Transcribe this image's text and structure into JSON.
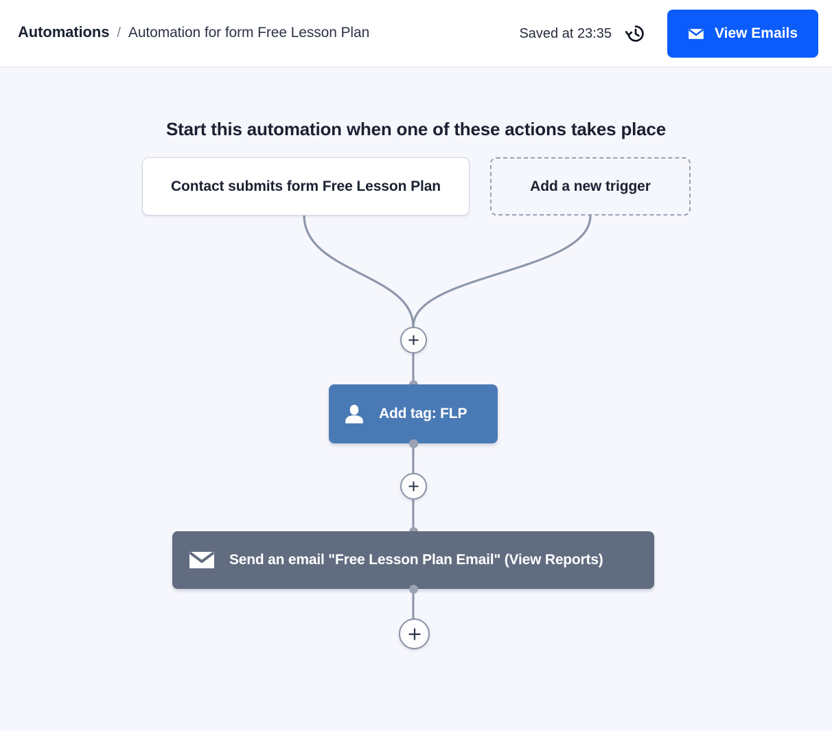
{
  "header": {
    "breadcrumb": {
      "root": "Automations",
      "separator": "/",
      "current": "Automation for form Free Lesson Plan"
    },
    "saved_status": "Saved at 23:35",
    "history_icon": "history-clock-icon",
    "view_emails": {
      "label": "View Emails",
      "icon": "envelope-icon",
      "color": "#0b5cfb"
    }
  },
  "canvas": {
    "background_color": "#f6f7fc",
    "flow_title": "Start this automation when one of these actions takes place",
    "triggers": [
      {
        "label": "Contact submits form Free Lesson Plan",
        "style": "solid"
      },
      {
        "label": "Add a new trigger",
        "style": "dashed"
      }
    ],
    "actions": [
      {
        "label": "Add tag: FLP",
        "icon": "person-icon",
        "color": "#4a7ab5"
      },
      {
        "label": "Send an email \"Free Lesson Plan Email\" (View Reports)",
        "icon": "envelope-icon",
        "color": "#616c80"
      }
    ],
    "add_step_buttons": [
      {
        "name": "add-step-after-triggers",
        "glyph": "+"
      },
      {
        "name": "add-step-after-add-tag",
        "glyph": "+"
      },
      {
        "name": "add-step-after-send-email",
        "glyph": "+"
      }
    ],
    "connector_color": "#8e97ab"
  }
}
